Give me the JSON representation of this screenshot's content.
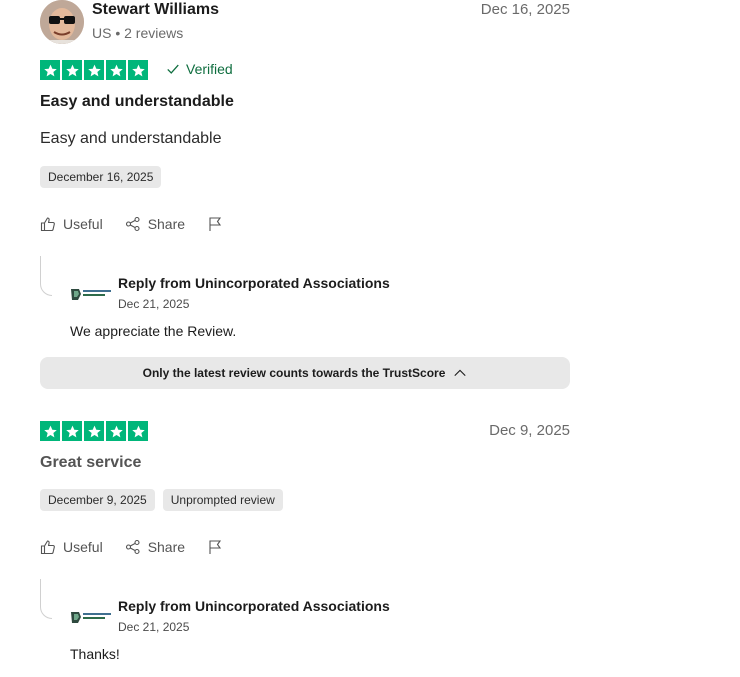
{
  "review1": {
    "reviewer_name": "Stewart Williams",
    "reviewer_meta": "US • 2 reviews",
    "date": "Dec 16, 2025",
    "rating": 5,
    "verified_label": "Verified",
    "title": "Easy and understandable",
    "body": "Easy and understandable",
    "date_chip": "December 16, 2025",
    "actions": {
      "useful": "Useful",
      "share": "Share"
    },
    "reply": {
      "title": "Reply from Unincorporated Associations",
      "date": "Dec 21, 2025",
      "text": "We appreciate the Review."
    }
  },
  "trust_bar": {
    "label": "Only the latest review counts towards the TrustScore"
  },
  "review2": {
    "date": "Dec 9, 2025",
    "rating": 5,
    "title": "Great service",
    "date_chip": "December 9, 2025",
    "tag_chip": "Unprompted review",
    "actions": {
      "useful": "Useful",
      "share": "Share"
    },
    "reply": {
      "title": "Reply from Unincorporated Associations",
      "date": "Dec 21, 2025",
      "text": "Thanks!"
    }
  },
  "colors": {
    "star_green": "#00b67a",
    "verified_green": "#0f6e3f",
    "chip_bg": "#e8e8e8"
  },
  "icons": [
    "star-icon",
    "check-icon",
    "thumbs-up-icon",
    "share-icon",
    "flag-icon",
    "chevron-up-icon"
  ]
}
